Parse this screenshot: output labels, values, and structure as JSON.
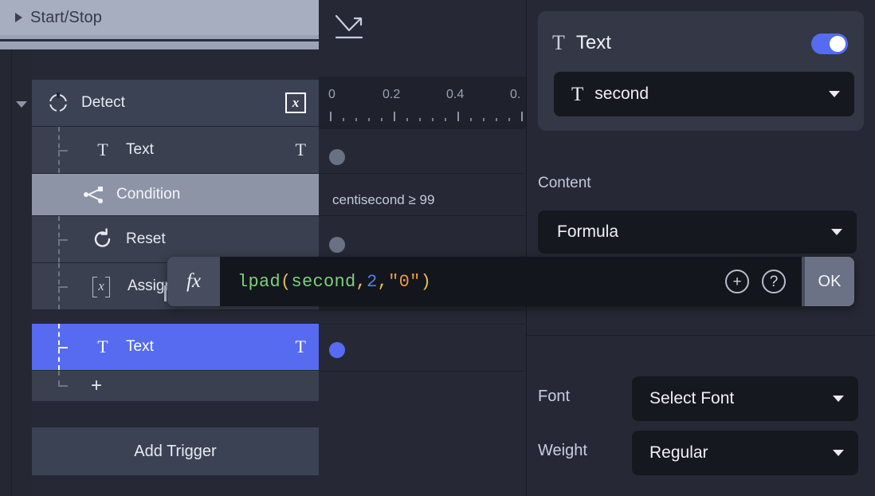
{
  "top_group": {
    "title": "Start/Stop",
    "caret_icon": "triangle-right-icon"
  },
  "track_rows": [
    {
      "label": "Detect",
      "icon": "crosshair-icon",
      "badge": "x",
      "right_icon": "",
      "level": 0,
      "state": "normal"
    },
    {
      "label": "Text",
      "icon": "text-t-icon",
      "badge": "",
      "right_icon": "T",
      "level": 1,
      "state": "normal"
    },
    {
      "label": "Condition",
      "icon": "branch-icon",
      "badge": "",
      "right_icon": "",
      "level": 1,
      "state": "selected-gray"
    },
    {
      "label": "Reset",
      "icon": "reset-loop-icon",
      "badge": "",
      "right_icon": "",
      "level": 1,
      "state": "normal"
    },
    {
      "label": "Assign",
      "icon": "variable-icon",
      "badge": "",
      "right_icon": "",
      "level": 1,
      "state": "normal"
    },
    {
      "label": "Text",
      "icon": "text-t-icon",
      "badge": "",
      "right_icon": "T",
      "level": 1,
      "state": "selected-blue"
    },
    {
      "label": "+",
      "icon": "",
      "badge": "",
      "right_icon": "",
      "level": 1,
      "state": "add"
    }
  ],
  "add_trigger": {
    "label": "Add Trigger"
  },
  "timeline": {
    "curve_icon": "ease-curve-icon",
    "ruler_ticks": [
      "0",
      "0.2",
      "0.4",
      "0."
    ],
    "condition_text": "centisecond ≥ 99",
    "keyframes": [
      {
        "track": "Text",
        "color": "#6a7184"
      },
      {
        "track": "Reset",
        "color": "#6a7184"
      },
      {
        "track": "Text 2",
        "color": "#566bf0"
      }
    ]
  },
  "formula_bar": {
    "fx_label": "fx",
    "expression": "lpad(second,2,\"0\")",
    "tokens": [
      {
        "text": "lpad",
        "type": "fn"
      },
      {
        "text": "(",
        "type": "punct"
      },
      {
        "text": "second",
        "type": "var"
      },
      {
        "text": ",",
        "type": "punct"
      },
      {
        "text": "2",
        "type": "num"
      },
      {
        "text": ",",
        "type": "punct"
      },
      {
        "text": "\"0\"",
        "type": "str"
      },
      {
        "text": ")",
        "type": "punct"
      }
    ],
    "add_icon": "plus-circle-icon",
    "help_icon": "question-circle-icon",
    "ok_label": "OK"
  },
  "properties": {
    "card": {
      "icon": "text-t-icon",
      "title": "Text",
      "enabled": true,
      "target_icon": "text-t-icon",
      "target_value": "second"
    },
    "content": {
      "label": "Content",
      "value": "Formula"
    },
    "font": {
      "label": "Font",
      "value": "Select Font"
    },
    "weight": {
      "label": "Weight",
      "value": "Regular"
    }
  },
  "colors": {
    "accent": "#566bf0",
    "panel": "#262935",
    "row": "#3b4253",
    "selected_gray": "#8d94a6",
    "code_bg": "#14161d"
  }
}
